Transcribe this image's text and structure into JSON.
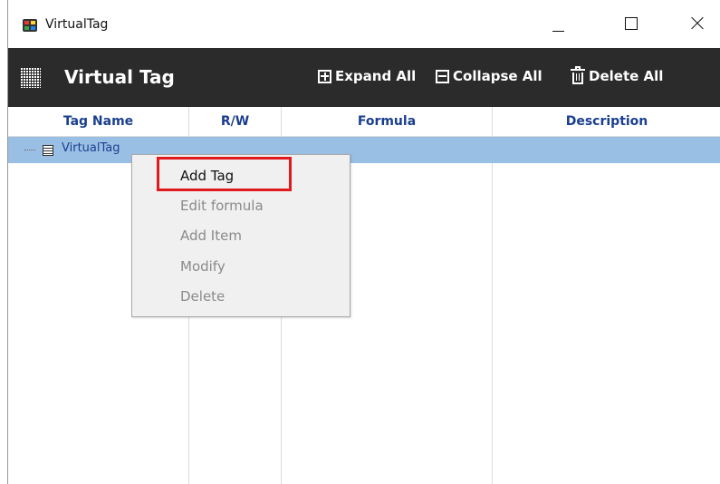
{
  "window": {
    "title": "VirtualTag",
    "controls": {
      "minimize": "minimize",
      "maximize": "maximize",
      "close": "close"
    }
  },
  "header": {
    "title": "Virtual Tag",
    "expand_all": "Expand All",
    "collapse_all": "Collapse All",
    "delete_all": "Delete All"
  },
  "table": {
    "columns": [
      "Tag Name",
      "R/W",
      "Formula",
      "Description"
    ],
    "rows": [
      {
        "name": "VirtualTag",
        "rw": "",
        "formula": "",
        "description": "",
        "selected": true
      }
    ]
  },
  "context_menu": {
    "items": [
      {
        "label": "Add Tag",
        "enabled": true,
        "highlighted": true
      },
      {
        "label": "Edit formula",
        "enabled": false
      },
      {
        "label": "Add Item",
        "enabled": false
      },
      {
        "label": "Modify",
        "enabled": false
      },
      {
        "label": "Delete",
        "enabled": false
      }
    ]
  },
  "colors": {
    "header_bg": "#2b2b2b",
    "selected_row": "#99c0e4",
    "column_header_text": "#1a3f8f",
    "highlight_box": "#e0191e",
    "menu_bg": "#f0f0f0"
  }
}
